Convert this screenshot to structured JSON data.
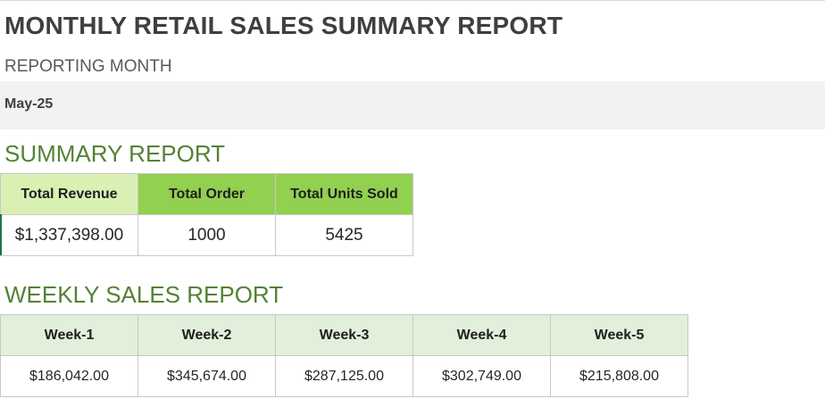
{
  "report": {
    "title": "MONTHLY RETAIL SALES SUMMARY REPORT",
    "reporting_month_label": "REPORTING MONTH",
    "reporting_month_value": "May-25"
  },
  "summary": {
    "title": "SUMMARY REPORT",
    "headers": [
      "Total Revenue",
      "Total Order",
      "Total Units Sold"
    ],
    "values": [
      "$1,337,398.00",
      "1000",
      "5425"
    ]
  },
  "weekly": {
    "title": "WEEKLY SALES REPORT",
    "headers": [
      "Week-1",
      "Week-2",
      "Week-3",
      "Week-4",
      "Week-5"
    ],
    "values": [
      "$186,042.00",
      "$345,674.00",
      "$287,125.00",
      "$302,749.00",
      "$215,808.00"
    ]
  },
  "colors": {
    "accent_green": "#548235",
    "header_light_green": "#d9f0b3",
    "header_green": "#92d050",
    "weekly_header_bg": "#e2efda",
    "month_band_bg": "#f2f2f2"
  }
}
